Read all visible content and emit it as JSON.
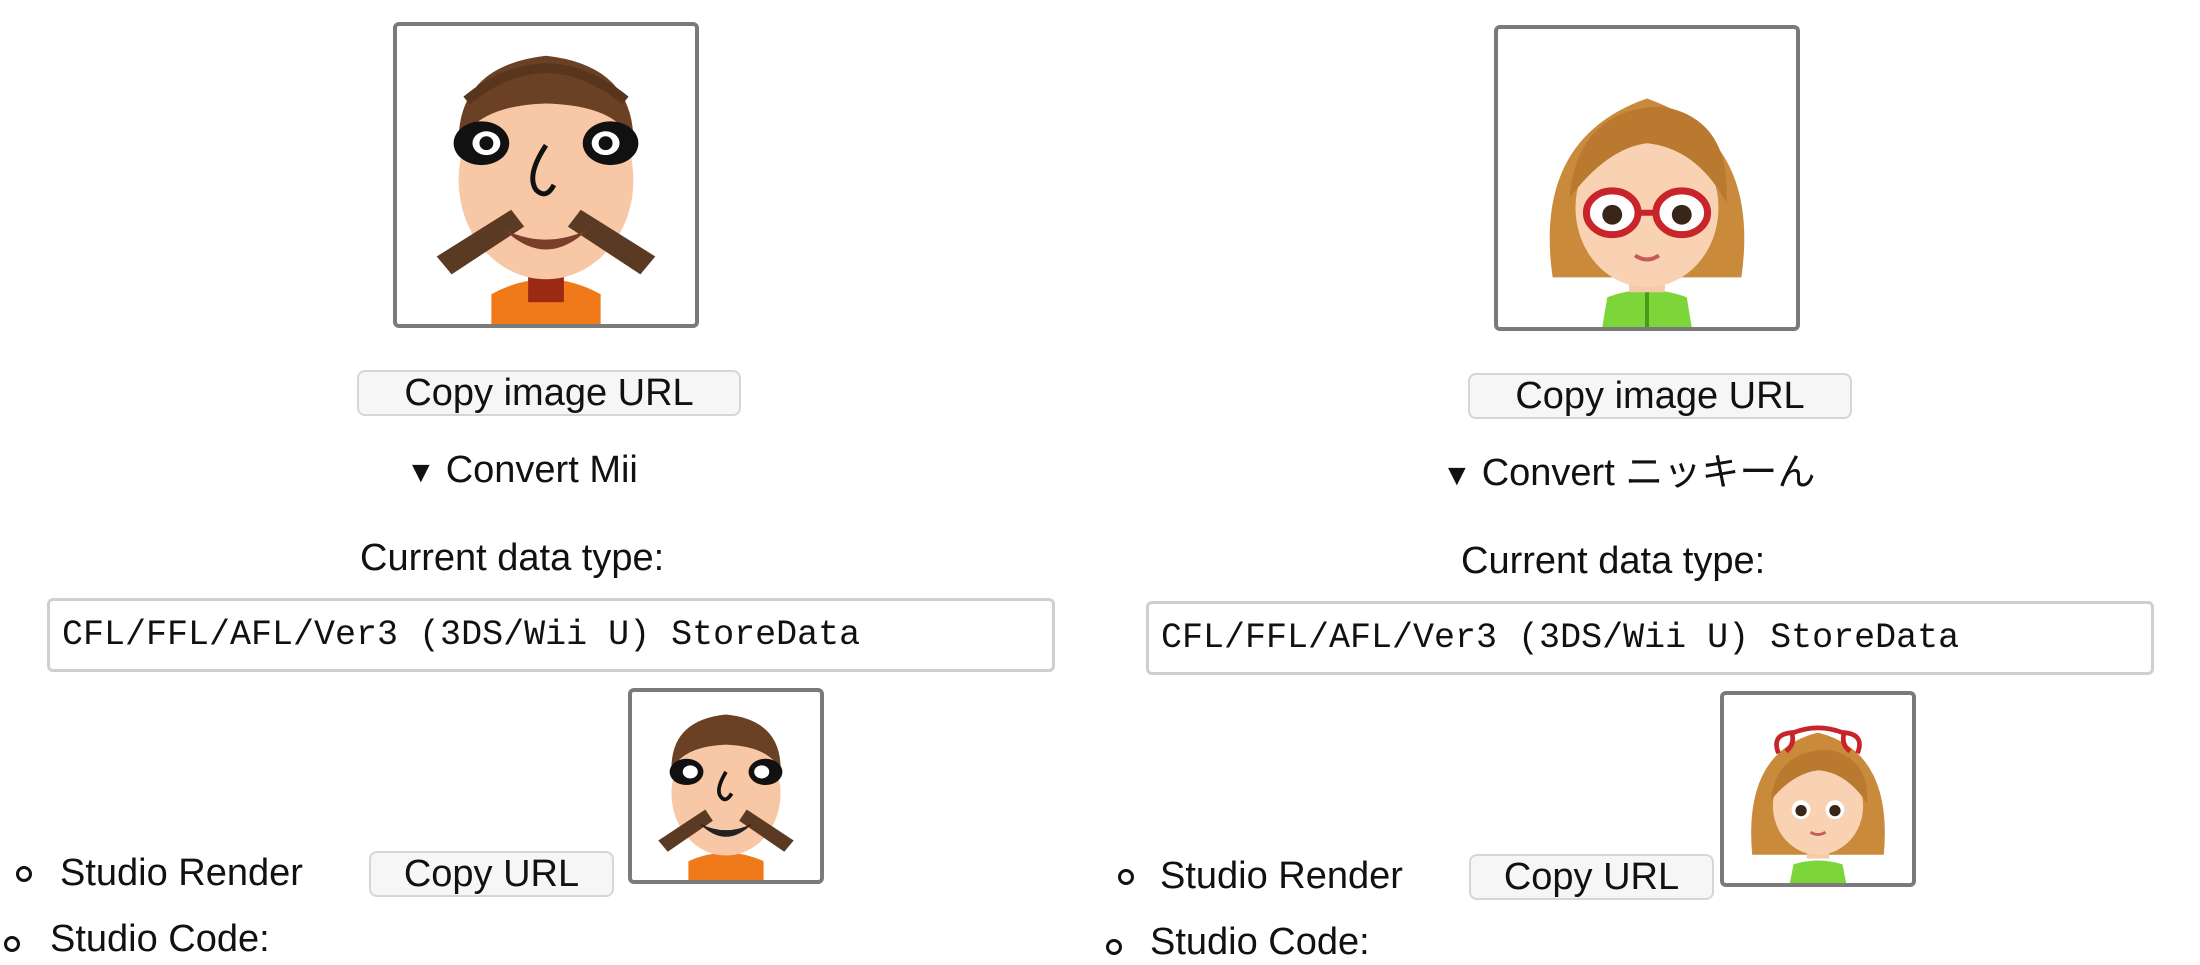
{
  "cards": [
    {
      "copy_image_url_label": "Copy image URL",
      "convert_summary": "Convert Mii",
      "current_data_type_label": "Current data type:",
      "data_type_value": "CFL/FFL/AFL/Ver3 (3DS/Wii U) StoreData",
      "studio_render_label": "Studio Render",
      "copy_url_label": "Copy URL",
      "studio_code_label": "Studio Code:",
      "portrait_icon": "mii-portrait-boy",
      "render_icon": "studio-render-boy"
    },
    {
      "copy_image_url_label": "Copy image URL",
      "convert_summary": "Convert ニッキーん",
      "current_data_type_label": "Current data type:",
      "data_type_value": "CFL/FFL/AFL/Ver3 (3DS/Wii U) StoreData",
      "studio_render_label": "Studio Render",
      "copy_url_label": "Copy URL",
      "studio_code_label": "Studio Code:",
      "portrait_icon": "mii-portrait-girl",
      "render_icon": "studio-render-girl"
    }
  ],
  "disclosure_icon": "triangle-down",
  "colors": {
    "frame_border": "#7a7a7a",
    "button_bg": "#f6f6f6",
    "button_border": "#d6d6d6",
    "textbox_border": "#cfcfcf"
  }
}
